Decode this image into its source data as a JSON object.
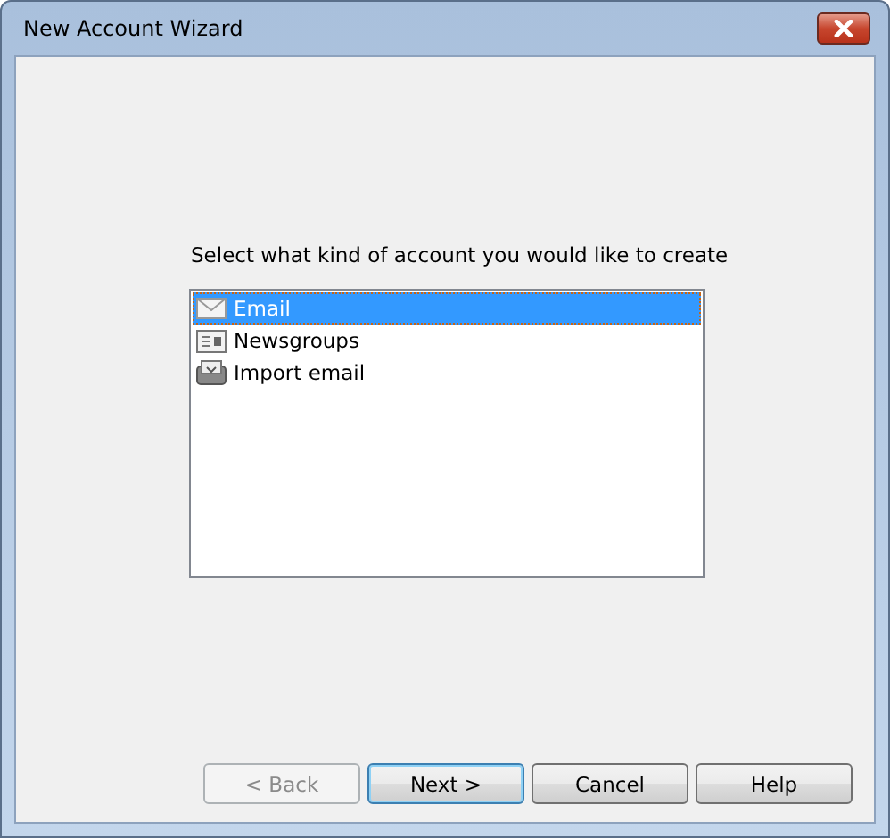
{
  "window": {
    "title": "New Account Wizard"
  },
  "prompt": "Select what kind of account you would like to create",
  "account_types": [
    {
      "label": "Email",
      "kind": "email",
      "selected": true
    },
    {
      "label": "Newsgroups",
      "kind": "news",
      "selected": false
    },
    {
      "label": "Import email",
      "kind": "import",
      "selected": false
    }
  ],
  "buttons": [
    {
      "label": "< Back",
      "disabled": true,
      "default": false
    },
    {
      "label": "Next >",
      "disabled": false,
      "default": true
    },
    {
      "label": "Cancel",
      "disabled": false,
      "default": false
    },
    {
      "label": "Help",
      "disabled": false,
      "default": false
    }
  ]
}
